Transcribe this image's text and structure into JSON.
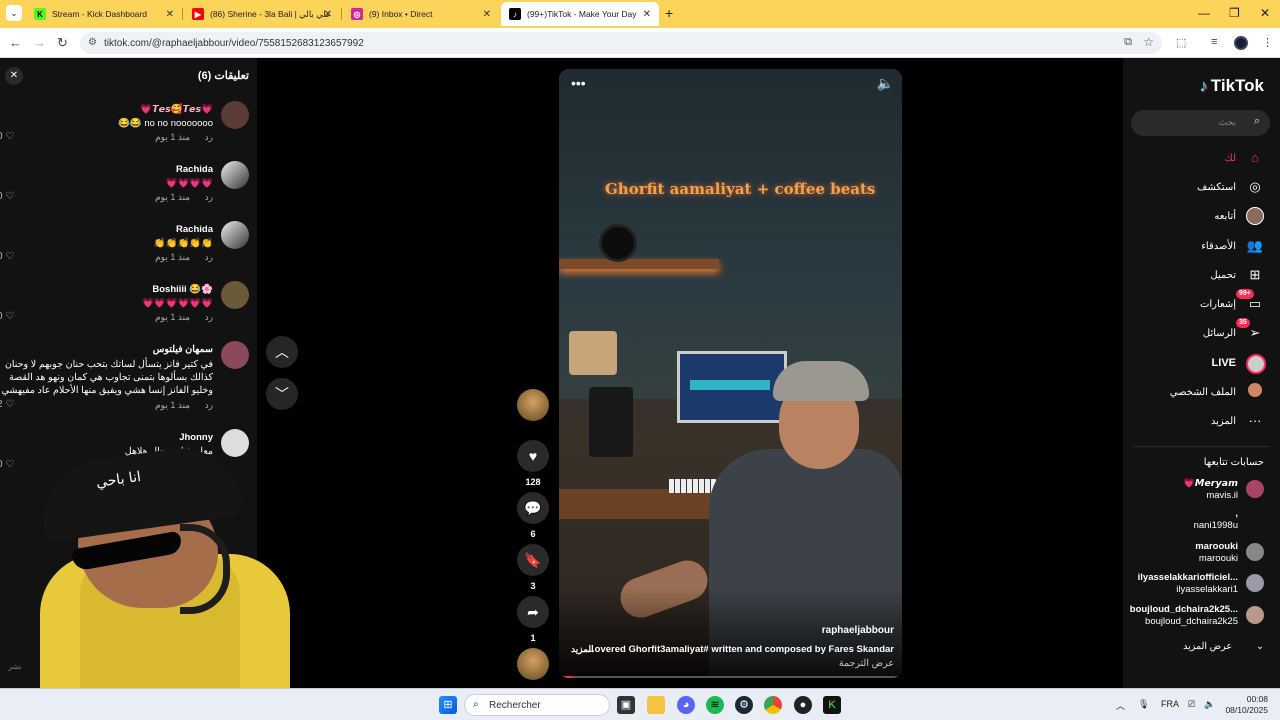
{
  "browser": {
    "tabs": [
      {
        "title": "Stream - Kick Dashboard",
        "favicon": "kick-icon",
        "color": "#53fc18"
      },
      {
        "title": "(86) Sherine - 3la Bali | علي بالي",
        "favicon": "youtube-icon",
        "color": "#ff0000"
      },
      {
        "title": "(9) Inbox • Direct",
        "favicon": "instagram-icon",
        "color": "#d6249f"
      },
      {
        "title": "(99+)TikTok - Make Your Day",
        "favicon": "tiktok-icon",
        "color": "#000000",
        "active": true
      }
    ],
    "url": "tiktok.com/@raphaeljabbour/video/7558152683123657992"
  },
  "comments": {
    "title": "تعليقات (6)",
    "reply_label": "رد",
    "items": [
      {
        "name": "💗𝙏𝙚𝙨🥰𝙏𝙚𝙨💗",
        "text": "no no nooooooo 😂😂",
        "time": "منذ 1 يوم",
        "likes": "0"
      },
      {
        "name": "Rachida",
        "text": "💗💗💗💗",
        "time": "منذ 1 يوم",
        "likes": "0"
      },
      {
        "name": "Rachida",
        "text": "👏👏👏👏👏",
        "time": "منذ 1 يوم",
        "likes": "0"
      },
      {
        "name": "Boshiiii 😂🌸",
        "text": "💗💗💗💗💗💗",
        "time": "منذ 1 يوم",
        "likes": "0"
      },
      {
        "name": "سمهان فيلتوس",
        "text": "في كتير فانز يتسأل لساتك بتحب حنان جوبهم لا وحنان كذالك بسألوها بتمنى تجاوب هي كمان ونهو هد القصة وخليو الفانز إنسا هشي ويفيق منها الأحلام عاد مفيهشي",
        "time": "منذ 1 يوم",
        "likes": "2"
      },
      {
        "name": "Jhonny",
        "text": "معلم فنان مجال هلاهل",
        "time": "",
        "likes": "0"
      }
    ]
  },
  "webcam": {
    "cap_text": "انا باحي",
    "corner_text": "نشر"
  },
  "video": {
    "neon_sign": "Ghorfit aamaliyat + coffee beats",
    "author": "raphaeljabbour",
    "caption": "...overed  Ghorfit3amaliyat# written and composed by Fares Skandar",
    "more_label": "المزيد",
    "translate_label": "عرض الترجمة",
    "progress": 0.04
  },
  "actions": {
    "likes": "128",
    "comments": "6",
    "saves": "3",
    "shares": "1"
  },
  "tiktok_nav": {
    "logo": "TikTok",
    "search_placeholder": "بحث",
    "items": [
      {
        "label": "لك",
        "icon": "home-icon",
        "active": true
      },
      {
        "label": "استكشف",
        "icon": "compass-icon"
      },
      {
        "label": "أتابعه",
        "icon": "following-avatar-icon"
      },
      {
        "label": "الأصدقاء",
        "icon": "friends-icon"
      },
      {
        "label": "تحميل",
        "icon": "upload-icon"
      },
      {
        "label": "إشعارات",
        "icon": "inbox-icon",
        "badge": "99+"
      },
      {
        "label": "الرسائل",
        "icon": "messages-icon",
        "badge": "35"
      },
      {
        "label": "LIVE",
        "icon": "live-icon"
      },
      {
        "label": "الملف الشخصي",
        "icon": "profile-icon"
      },
      {
        "label": "المزيد",
        "icon": "more-icon"
      }
    ],
    "following_title": "حسابات تتابعها",
    "following": [
      {
        "name": "💗𝙈𝙚𝙧𝙮𝙖𝙢",
        "handle": "mavis.il"
      },
      {
        "name": ",",
        "handle": "nani1998u"
      },
      {
        "name": "maroouki",
        "handle": "maroouki"
      },
      {
        "name": "ilyasselakkariofficiel...",
        "handle": "ilyasselakkari1"
      },
      {
        "name": "boujloud_dchaira2k25...",
        "handle": "boujloud_dchaira2k25"
      }
    ],
    "see_more": "عرض المزيد"
  },
  "taskbar": {
    "search_placeholder": "Rechercher",
    "language": "FRA",
    "time": "00:08",
    "date": "08/10/2025"
  }
}
